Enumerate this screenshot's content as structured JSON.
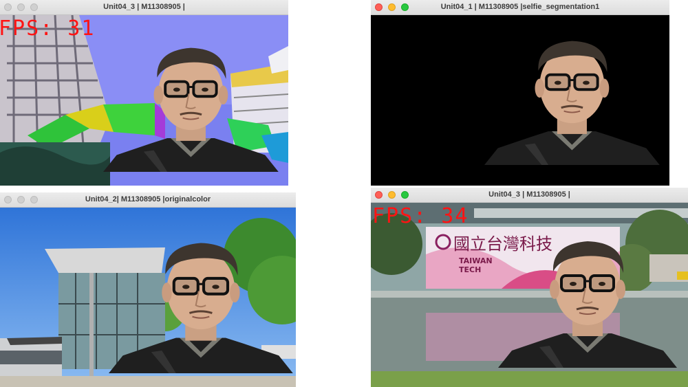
{
  "windows": {
    "top_left": {
      "title": "Unit04_3 | M11308905 |",
      "fps_label": "FPS: 31"
    },
    "top_right": {
      "title": "Unit04_1 | M11308905 |selfie_segmentation1"
    },
    "bottom_left": {
      "title": "Unit04_2| M11308905 |originalcolor"
    },
    "bottom_right": {
      "title": "Unit04_3 | M11308905 |",
      "fps_label": "FPS: 34"
    }
  },
  "banner": {
    "line1": "國立台灣科技",
    "line2": "TAIWAN",
    "line3": "TECH"
  },
  "colors": {
    "fps_text": "#ff1414",
    "traffic_close": "#fe5f57",
    "traffic_min": "#febc2e",
    "traffic_max": "#28c840"
  },
  "icons": [
    "close-icon",
    "minimize-icon",
    "zoom-icon"
  ]
}
